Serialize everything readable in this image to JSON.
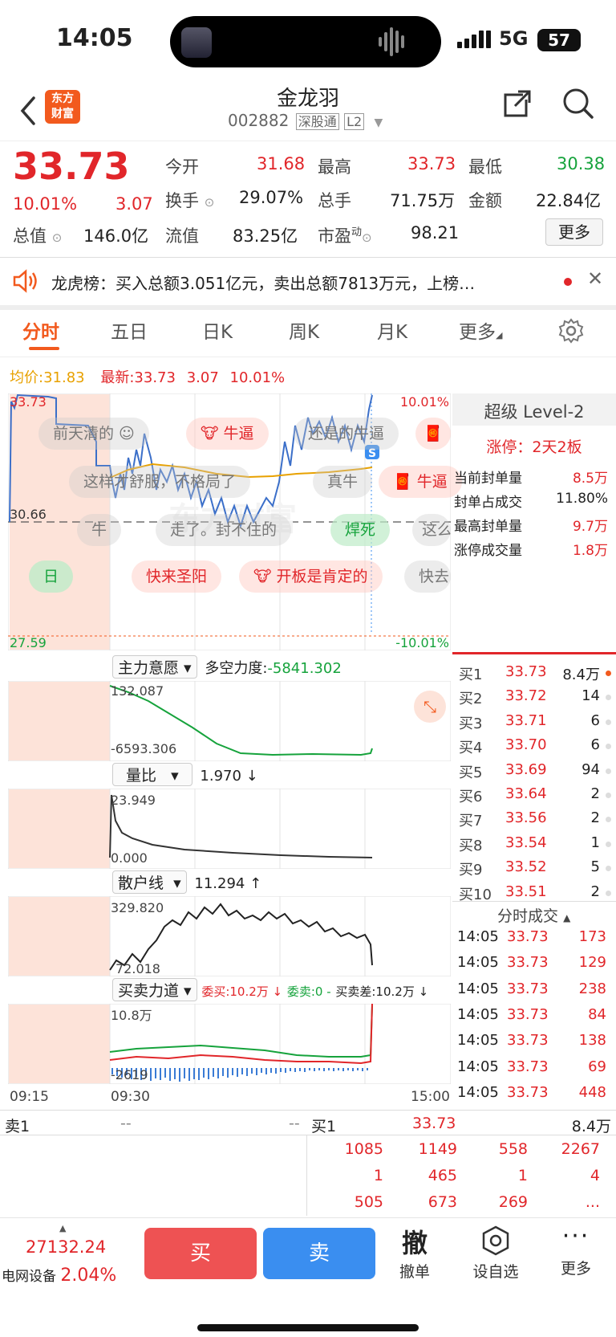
{
  "status": {
    "time": "14:05",
    "network": "5G",
    "battery": "57"
  },
  "header": {
    "title": "金龙羽",
    "code": "002882",
    "badge1": "深股通",
    "badge2": "L2",
    "logo_line1": "东方",
    "logo_line2": "财富"
  },
  "quote": {
    "price": "33.73",
    "pct": "10.01%",
    "change": "3.07",
    "open_label": "今开",
    "open": "31.68",
    "high_label": "最高",
    "high": "33.73",
    "low_label": "最低",
    "low": "30.38",
    "turnover_label": "换手",
    "turnover": "29.07%",
    "vol_label": "总手",
    "vol": "71.75万",
    "amount_label": "金额",
    "amount": "22.84亿",
    "mcap_label": "总值",
    "mcap": "146.0亿",
    "float_label": "流值",
    "float": "83.25亿",
    "pe_label": "市盈",
    "pe_sup": "动",
    "pe": "98.21",
    "more": "更多"
  },
  "notice": {
    "label": "龙虎榜：",
    "text": "买入总额3.051亿元，卖出总额7813万元，上榜…"
  },
  "tabs": [
    "分时",
    "五日",
    "日K",
    "周K",
    "月K",
    "更多"
  ],
  "chart_info": {
    "avg_label": "均价:",
    "avg": "31.83",
    "latest_label": "最新:",
    "latest": "33.73",
    "change": "3.07",
    "pct": "10.01%"
  },
  "main_chart": {
    "top_left": "33.73",
    "top_right": "10.01%",
    "mid_left": "30.66",
    "bottom_left": "27.59",
    "bottom_right": "-10.01%",
    "badge": "S"
  },
  "danmaku": [
    "前天清的",
    "牛逼",
    "还是的牛逼",
    "这样才舒服，不格局了",
    "真牛",
    "牛逼",
    "牛",
    "走了。封不住的",
    "焊死",
    "这么",
    "日",
    "快来圣阳",
    "开板是肯定的",
    "快去"
  ],
  "level2": {
    "title": "超级 Level-2",
    "limit": "涨停：2天2板",
    "rows": [
      {
        "label": "当前封单量",
        "value": "8.5万"
      },
      {
        "label": "封单占成交",
        "value": "11.80%"
      },
      {
        "label": "最高封单量",
        "value": "9.7万"
      },
      {
        "label": "涨停成交量",
        "value": "1.8万"
      }
    ]
  },
  "indicators": [
    {
      "name": "主力意愿",
      "label2": "多空力度:",
      "value": "-5841.302",
      "top": "132.087",
      "bottom": "-6593.306"
    },
    {
      "name": "量比",
      "value": "1.970 ↓",
      "top": "23.949",
      "bottom": "0.000"
    },
    {
      "name": "散户线",
      "value": "11.294 ↑",
      "top": "329.820",
      "bottom": "72.018"
    },
    {
      "name": "买卖力道",
      "buy": "委买:10.2万 ↓",
      "sell": "委卖:0 -",
      "diff": "买卖差:10.2万 ↓",
      "top": "10.8万",
      "bottom": "-2619"
    }
  ],
  "time_axis": [
    "09:15",
    "09:30",
    "15:00"
  ],
  "orderbook": [
    {
      "label": "买1",
      "price": "33.73",
      "vol": "8.4万"
    },
    {
      "label": "买2",
      "price": "33.72",
      "vol": "14"
    },
    {
      "label": "买3",
      "price": "33.71",
      "vol": "6"
    },
    {
      "label": "买4",
      "price": "33.70",
      "vol": "6"
    },
    {
      "label": "买5",
      "price": "33.69",
      "vol": "94"
    },
    {
      "label": "买6",
      "price": "33.64",
      "vol": "2"
    },
    {
      "label": "买7",
      "price": "33.56",
      "vol": "2"
    },
    {
      "label": "买8",
      "price": "33.54",
      "vol": "1"
    },
    {
      "label": "买9",
      "price": "33.52",
      "vol": "5"
    },
    {
      "label": "买10",
      "price": "33.51",
      "vol": "2"
    }
  ],
  "ticks_title": "分时成交",
  "ticks": [
    {
      "time": "14:05",
      "price": "33.73",
      "vol": "173"
    },
    {
      "time": "14:05",
      "price": "33.73",
      "vol": "129"
    },
    {
      "time": "14:05",
      "price": "33.73",
      "vol": "238"
    },
    {
      "time": "14:05",
      "price": "33.73",
      "vol": "84"
    },
    {
      "time": "14:05",
      "price": "33.73",
      "vol": "138"
    },
    {
      "time": "14:05",
      "price": "33.73",
      "vol": "69"
    },
    {
      "time": "14:05",
      "price": "33.73",
      "vol": "448"
    }
  ],
  "queue": {
    "sell_label": "卖1",
    "sell_a": "--",
    "sell_b": "--",
    "buy_label": "买1",
    "buy_price": "33.73",
    "buy_vol": "8.4万",
    "rows": [
      [
        "1085",
        "1149",
        "558",
        "2267"
      ],
      [
        "1",
        "465",
        "1",
        "4"
      ],
      [
        "505",
        "673",
        "269",
        "..."
      ]
    ]
  },
  "bottom": {
    "index": "27132.24",
    "sector": "电网设备",
    "sector_pct": "2.04%",
    "buy": "买",
    "sell": "卖",
    "cancel_icon": "撤",
    "cancel": "撤单",
    "watch": "设自选",
    "more": "更多"
  },
  "colors": {
    "up": "#e1262a",
    "down": "#16a33c",
    "accent": "#f25a1e",
    "buy_btn": "#ee5253",
    "sell_btn": "#3a8ef0"
  }
}
